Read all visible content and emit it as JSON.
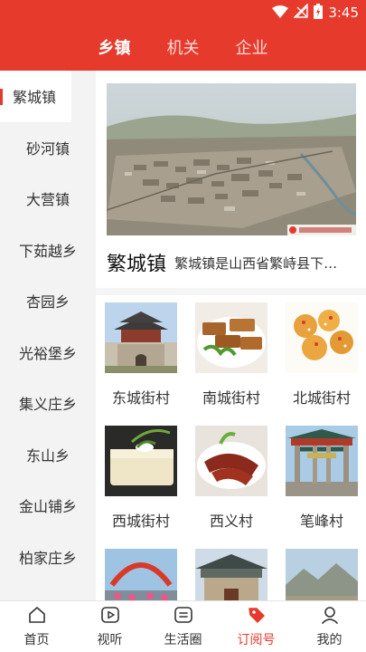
{
  "status": {
    "time": "3:45"
  },
  "tabs": [
    {
      "label": "乡镇"
    },
    {
      "label": "机关"
    },
    {
      "label": "企业"
    }
  ],
  "sidebar": {
    "items": [
      {
        "label": "繁城镇"
      },
      {
        "label": "砂河镇"
      },
      {
        "label": "大营镇"
      },
      {
        "label": "下茹越乡"
      },
      {
        "label": "杏园乡"
      },
      {
        "label": "光裕堡乡"
      },
      {
        "label": "集义庄乡"
      },
      {
        "label": "东山乡"
      },
      {
        "label": "金山铺乡"
      },
      {
        "label": "柏家庄乡"
      }
    ]
  },
  "hero": {
    "name": "繁城镇",
    "description": "繁城镇是山西省繁峙县下…"
  },
  "villages": [
    {
      "name": "东城街村"
    },
    {
      "name": "南城街村"
    },
    {
      "name": "北城街村"
    },
    {
      "name": "西城街村"
    },
    {
      "name": "西义村"
    },
    {
      "name": "笔峰村"
    },
    {
      "name": ""
    },
    {
      "name": ""
    },
    {
      "name": ""
    }
  ],
  "bottom_nav": [
    {
      "label": "首页",
      "icon": "home-icon"
    },
    {
      "label": "视听",
      "icon": "play-icon"
    },
    {
      "label": "生活圈",
      "icon": "list-icon"
    },
    {
      "label": "订阅号",
      "icon": "tag-icon"
    },
    {
      "label": "我的",
      "icon": "user-icon"
    }
  ],
  "colors": {
    "accent": "#e63a2c"
  }
}
